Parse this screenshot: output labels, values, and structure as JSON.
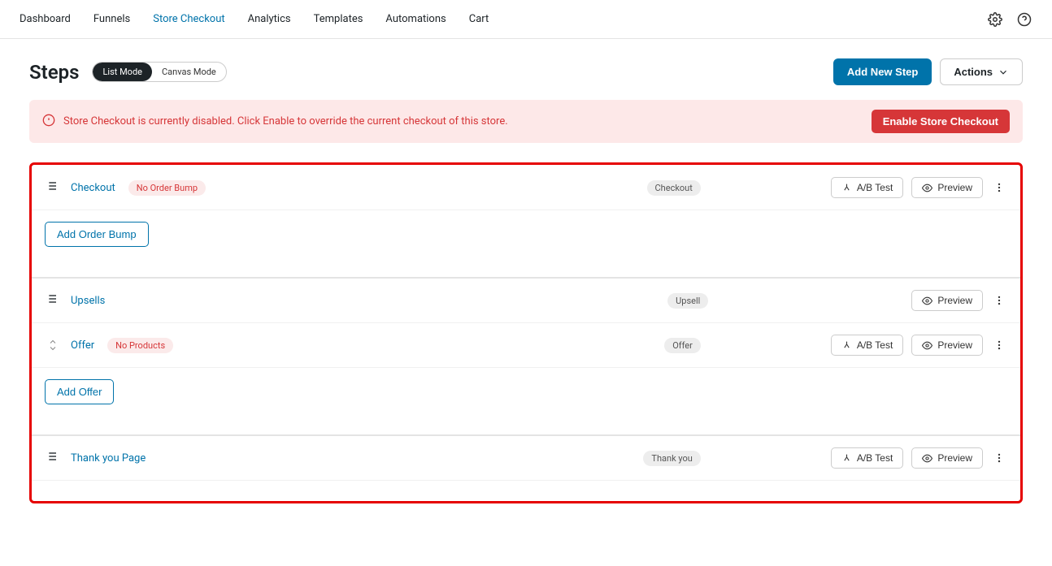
{
  "nav": {
    "items": [
      "Dashboard",
      "Funnels",
      "Store Checkout",
      "Analytics",
      "Templates",
      "Automations",
      "Cart"
    ],
    "active_index": 2
  },
  "header": {
    "title": "Steps",
    "mode_list": "List Mode",
    "mode_canvas": "Canvas Mode",
    "add_step": "Add New Step",
    "actions": "Actions"
  },
  "alert": {
    "text": "Store Checkout is currently disabled. Click Enable to override the current checkout of this store.",
    "cta": "Enable Store Checkout"
  },
  "steps": {
    "checkout": {
      "name": "Checkout",
      "badge": "No Order Bump",
      "tag": "Checkout",
      "ab": "A/B Test",
      "preview": "Preview",
      "add_bump": "Add Order Bump"
    },
    "upsells": {
      "name": "Upsells",
      "tag": "Upsell",
      "preview": "Preview"
    },
    "offer": {
      "name": "Offer",
      "badge": "No Products",
      "tag": "Offer",
      "ab": "A/B Test",
      "preview": "Preview",
      "add_offer": "Add Offer"
    },
    "thankyou": {
      "name": "Thank you Page",
      "tag": "Thank you",
      "ab": "A/B Test",
      "preview": "Preview"
    }
  }
}
